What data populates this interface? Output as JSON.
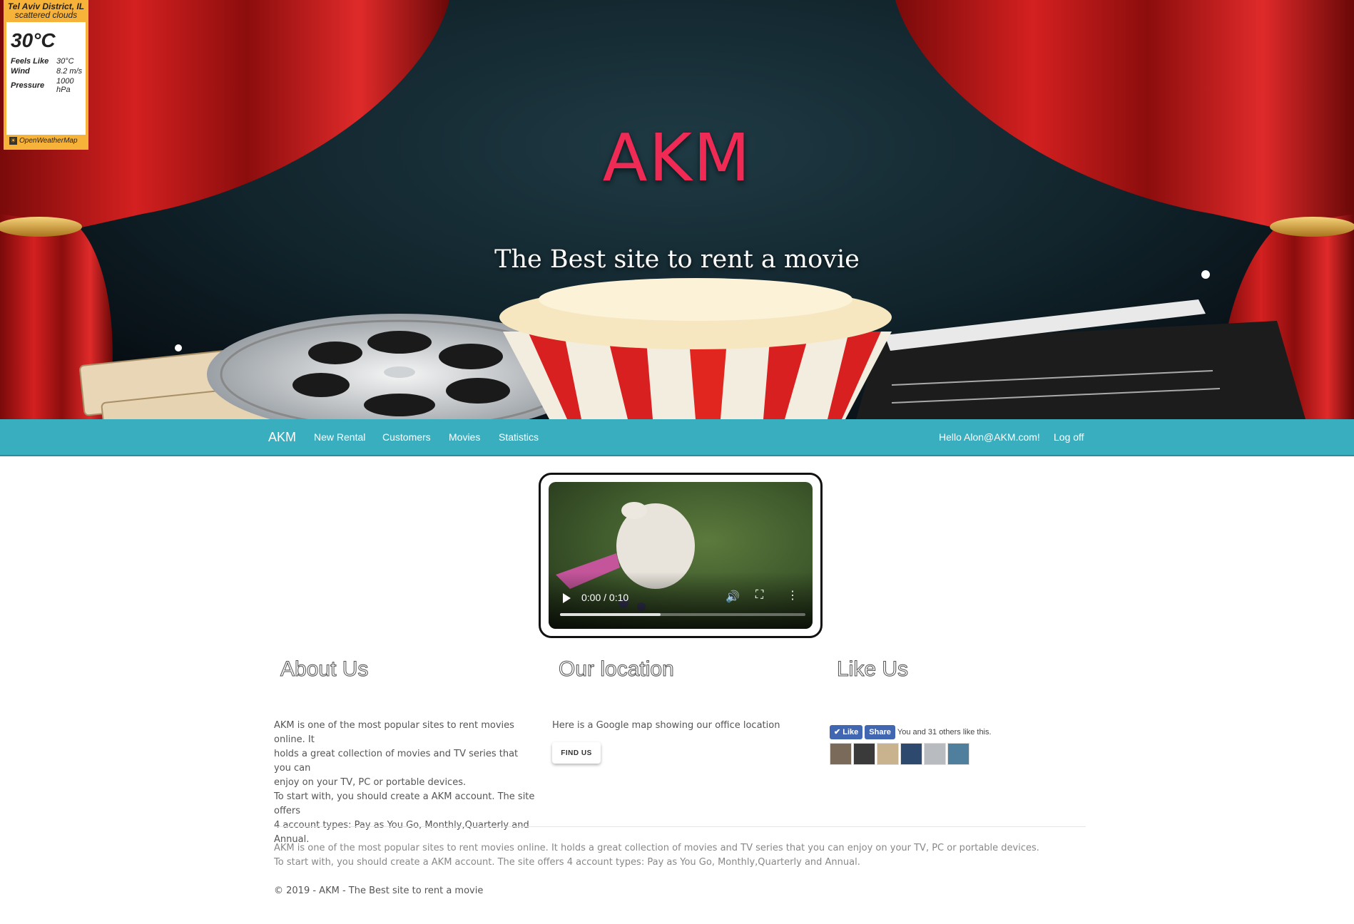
{
  "weather": {
    "city": "Tel Aviv District, IL",
    "description": "scattered clouds",
    "temperature": "30°C",
    "rows": [
      {
        "label": "Feels Like",
        "value": "30°C"
      },
      {
        "label": "Wind",
        "value": "8.2 m/s"
      },
      {
        "label": "Pressure",
        "value": "1000 hPa"
      }
    ],
    "provider": "OpenWeatherMap"
  },
  "hero": {
    "title": "AKM",
    "subtitle": "The Best site to rent a movie"
  },
  "nav": {
    "brand": "AKM",
    "items": [
      "New Rental",
      "Customers",
      "Movies",
      "Statistics"
    ],
    "greeting": "Hello Alon@AKM.com!",
    "logoff": "Log off"
  },
  "video": {
    "time": "0:00 / 0:10",
    "progress_buffered": 0.41
  },
  "about": {
    "heading": "About Us",
    "lines": [
      "AKM is one of the most popular sites to rent movies online. It",
      "holds a great collection of movies and TV series that you can",
      "enjoy on your TV, PC or portable devices.",
      "To start with, you should create a AKM account. The site offers",
      "4 account types: Pay as You Go, Monthly,Quarterly and",
      "Annual."
    ]
  },
  "location": {
    "heading": "Our location",
    "text": "Here is a Google map showing our office location",
    "button": "FIND US"
  },
  "like": {
    "heading": "Like Us",
    "like_label": "Like",
    "share_label": "Share",
    "count_text": "You and 31 others like this."
  },
  "footer": {
    "line1": "AKM is one of the most popular sites to rent movies online. It holds a great collection of movies and TV series that you can enjoy on your TV, PC or portable devices.",
    "line2": "To start with, you should create a AKM account. The site offers 4 account types: Pay as You Go, Monthly,Quarterly and Annual.",
    "copyright": "© 2019 - AKM - The Best site to rent a movie"
  },
  "colors": {
    "navbar": "#39aebf",
    "title": "#ee2a55",
    "weather_accent": "#f7b23a"
  }
}
